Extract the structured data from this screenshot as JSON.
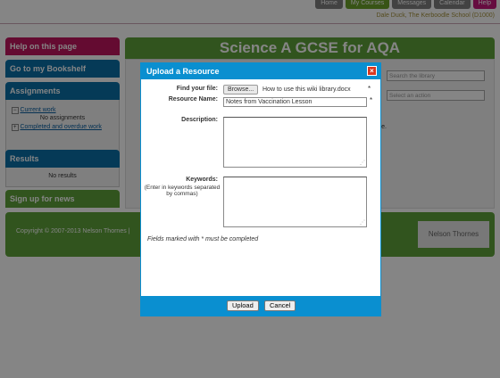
{
  "topnav": {
    "home": "Home",
    "my_courses": "My Courses",
    "messages": "Messages",
    "calendar": "Calendar",
    "help": "Help"
  },
  "user_line": "Dale Duck, The Kerboodle School (D1000)",
  "sidebar": {
    "help_label": "Help on this page",
    "bookshelf_label": "Go to my Bookshelf",
    "assignments": {
      "title": "Assignments",
      "current_work": "Current work",
      "no_assignments": "No assignments",
      "completed_overdue": "Completed and overdue work"
    },
    "results": {
      "title": "Results",
      "none": "No results"
    },
    "news_label": "Sign up for news"
  },
  "main": {
    "banner_title": "Science A GCSE for AQA",
    "search_placeholder": "Search the library",
    "action_placeholder": "Select an action",
    "partial_text": "ton above."
  },
  "footer": {
    "copyright": "Copyright © 2007-2013 Nelson Thornes |",
    "brand": "Nelson Thornes"
  },
  "dialog": {
    "title": "Upload a Resource",
    "close_glyph": "×",
    "find_file_label": "Find your file:",
    "browse_label": "Browse...",
    "file_name": "How to use this wiki library.docx",
    "required_mark": "*",
    "resource_name_label": "Resource Name:",
    "resource_name_value": "Notes from Vaccination Lesson",
    "description_label": "Description:",
    "keywords_label": "Keywords:",
    "keywords_hint": "(Enter in keywords separated by commas)",
    "required_note": "Fields marked with * must be completed",
    "upload_label": "Upload",
    "cancel_label": "Cancel"
  },
  "colors": {
    "brand_green": "#5ea13a",
    "brand_pink": "#c0165f",
    "brand_blue": "#0a6fa8",
    "dialog_blue": "#0a8fd0",
    "close_red": "#d9371f"
  }
}
